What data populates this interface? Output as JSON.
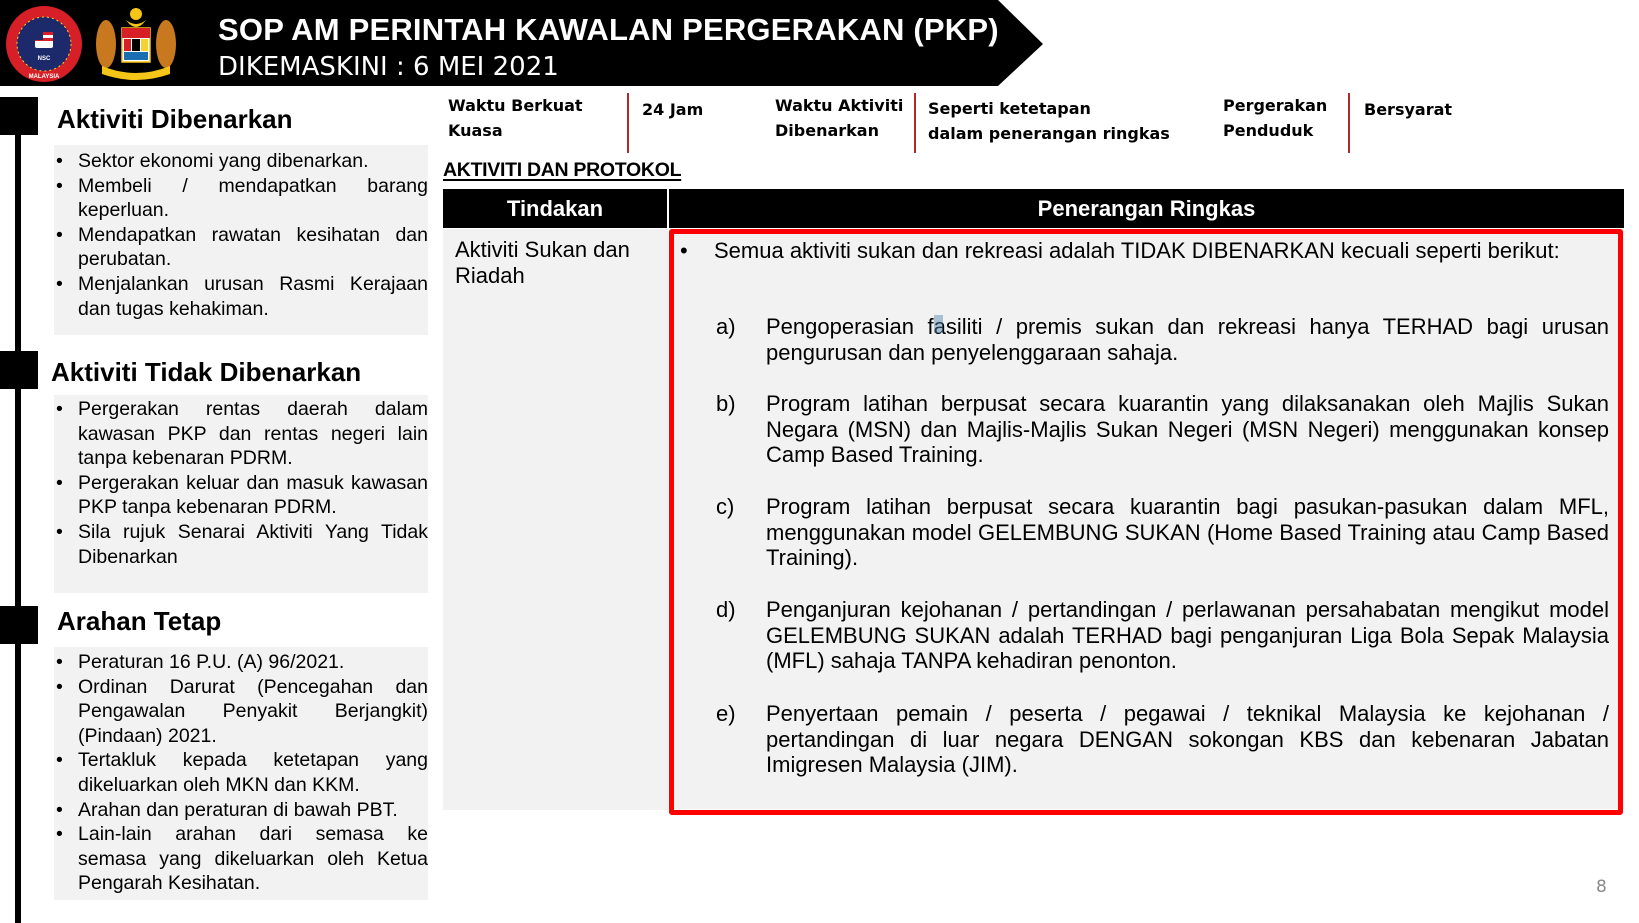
{
  "header": {
    "title": "SOP AM PERINTAH KAWALAN PERGERAKAN (PKP)",
    "subtitle": "DIKEMASKINI : 6 MEI 2021",
    "logos": [
      "nsc-malaysia-logo",
      "jata-negara-coat-of-arms"
    ],
    "nsc_logo_text": {
      "top": "MAJLIS KESELAMATAN NEGARA",
      "middle": "NSC",
      "bottom": "MALAYSIA"
    }
  },
  "info_row": {
    "waktu_berkuat_kuasa_label": [
      "Waktu Berkuat",
      "Kuasa"
    ],
    "waktu_berkuat_kuasa_value": "24 Jam",
    "waktu_aktiviti_label": [
      "Waktu Aktiviti",
      "Dibenarkan"
    ],
    "waktu_aktiviti_value": [
      "Seperti ketetapan",
      "dalam penerangan ringkas"
    ],
    "pergerakan_label": [
      "Pergerakan",
      "Penduduk"
    ],
    "pergerakan_value": "Bersyarat"
  },
  "sidebar": {
    "sections": [
      {
        "title": "Aktiviti Dibenarkan",
        "items": [
          "Sektor ekonomi yang dibenarkan.",
          "Membeli / mendapatkan barang keperluan.",
          "Mendapatkan rawatan kesihatan dan perubatan.",
          "Menjalankan urusan Rasmi Kerajaan dan tugas kehakiman."
        ]
      },
      {
        "title": "Aktiviti Tidak Dibenarkan",
        "items": [
          "Pergerakan rentas daerah dalam kawasan PKP dan rentas negeri lain tanpa kebenaran PDRM.",
          "Pergerakan keluar dan masuk kawasan PKP tanpa kebenaran PDRM.",
          "Sila rujuk Senarai Aktiviti Yang Tidak Dibenarkan"
        ]
      },
      {
        "title": "Arahan Tetap",
        "items": [
          "Peraturan 16 P.U. (A) 96/2021.",
          "Ordinan Darurat (Pencegahan dan Pengawalan Penyakit Berjangkit) (Pindaan) 2021.",
          "Tertakluk kepada ketetapan yang dikeluarkan oleh MKN dan KKM.",
          "Arahan dan peraturan di bawah  PBT.",
          "Lain-lain arahan dari semasa  ke semasa yang dikeluarkan oleh Ketua Pengarah Kesihatan."
        ]
      }
    ]
  },
  "main": {
    "section_label": "AKTIVITI DAN PROTOKOL",
    "table": {
      "headers": [
        "Tindakan",
        "Penerangan Ringkas"
      ],
      "row": {
        "tindakan": "Aktiviti Sukan dan Riadah",
        "intro": "Semua aktiviti sukan dan rekreasi adalah TIDAK DIBENARKAN kecuali seperti berikut:",
        "items": [
          {
            "letter": "a)",
            "text": "Pengoperasian fasiliti / premis sukan dan rekreasi hanya TERHAD bagi urusan pengurusan dan penyelenggaraan sahaja."
          },
          {
            "letter": "b)",
            "text": "Program latihan berpusat secara kuarantin yang dilaksanakan oleh Majlis Sukan Negara (MSN) dan Majlis-Majlis Sukan Negeri (MSN Negeri) menggunakan konsep Camp Based Training."
          },
          {
            "letter": "c)",
            "text": "Program latihan berpusat secara kuarantin bagi pasukan-pasukan dalam MFL, menggunakan model GELEMBUNG SUKAN (Home Based Training atau Camp Based Training)."
          },
          {
            "letter": "d)",
            "text": "Penganjuran kejohanan / pertandingan / perlawanan persahabatan mengikut model GELEMBUNG SUKAN adalah TERHAD bagi penganjuran Liga Bola Sepak Malaysia (MFL) sahaja TANPA kehadiran penonton."
          },
          {
            "letter": "e)",
            "text": "Penyertaan pemain / peserta / pegawai / teknikal Malaysia ke kejohanan / pertandingan di luar negara DENGAN sokongan KBS dan kebenaran Jabatan Imigresen Malaysia (JIM)."
          }
        ]
      }
    }
  },
  "footer": {
    "page_number": "8"
  },
  "colors": {
    "banner": "#000000",
    "highlight_border": "#ff0000",
    "divider": "#b02a2a",
    "panel": "#f2f2f2"
  }
}
